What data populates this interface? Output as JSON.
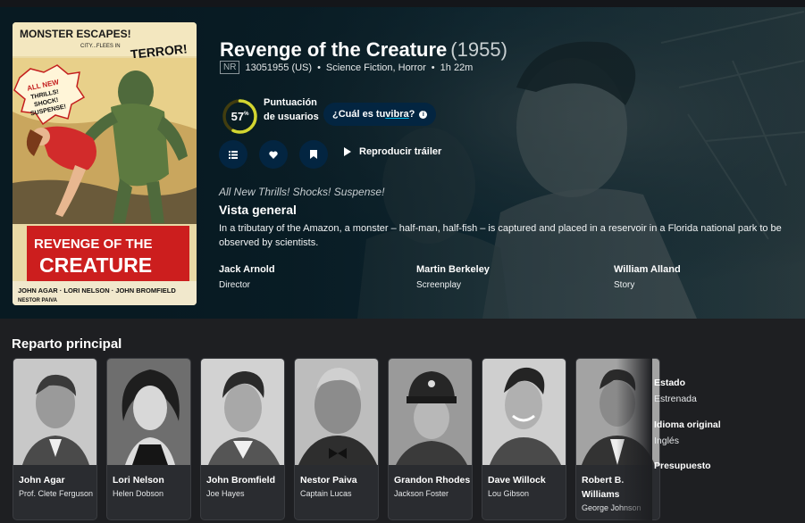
{
  "movie": {
    "title": "Revenge of the Creature",
    "year": "(1955)",
    "certification": "NR",
    "release": "13051955 (US)",
    "genres": "Science Fiction, Horror",
    "runtime": "1h 22m",
    "tagline": "All New Thrills! Shocks! Suspense!",
    "overview_heading": "Vista general",
    "overview": "In a tributary of the Amazon, a monster – half-man, half-fish – is captured and placed in a reservoir in a Florida national park to be observed by scientists."
  },
  "score": {
    "value": 57,
    "display": "57",
    "unit": "%",
    "label": "Puntuación de usuarios",
    "ring_color": "#d2d531",
    "track_color": "#423d0f"
  },
  "vibe": {
    "prefix": "¿Cuál es tu ",
    "link": "vibra",
    "suffix": "?"
  },
  "actions": {
    "list_icon": "list-icon",
    "favorite_icon": "heart-icon",
    "watchlist_icon": "bookmark-icon",
    "trailer_label": "Reproducir tráiler"
  },
  "poster": {
    "top_text": "MONSTER ESCAPES!",
    "sub_text": "CITY...FLEES IN",
    "terror": "TERROR!",
    "burst": [
      "ALL NEW",
      "THRILLS!",
      "SHOCK!",
      "SUSPENSE!"
    ],
    "title_line1": "REVENGE OF THE",
    "title_line2": "CREATURE",
    "starring": "JOHN AGAR · LORI NELSON · JOHN BROMFIELD",
    "starring2": "NESTOR PAIVA"
  },
  "crew": [
    {
      "name": "Jack Arnold",
      "job": "Director"
    },
    {
      "name": "Martin Berkeley",
      "job": "Screenplay"
    },
    {
      "name": "William Alland",
      "job": "Story"
    }
  ],
  "cast_heading": "Reparto principal",
  "cast": [
    {
      "name": "John Agar",
      "character": "Prof. Clete Ferguson"
    },
    {
      "name": "Lori Nelson",
      "character": "Helen Dobson"
    },
    {
      "name": "John Bromfield",
      "character": "Joe Hayes"
    },
    {
      "name": "Nestor Paiva",
      "character": "Captain Lucas"
    },
    {
      "name": "Grandon Rhodes",
      "character": "Jackson Foster"
    },
    {
      "name": "Dave Willock",
      "character": "Lou Gibson"
    },
    {
      "name": "Robert B. Williams",
      "character": "George Johnson"
    }
  ],
  "facts": [
    {
      "label": "Estado",
      "value": "Estrenada"
    },
    {
      "label": "Idioma original",
      "value": "Inglés"
    },
    {
      "label": "Presupuesto",
      "value": ""
    }
  ],
  "colors": {
    "button_bg": "#032541",
    "page_bg": "#1e1f22",
    "accent": "#01b4e4"
  }
}
